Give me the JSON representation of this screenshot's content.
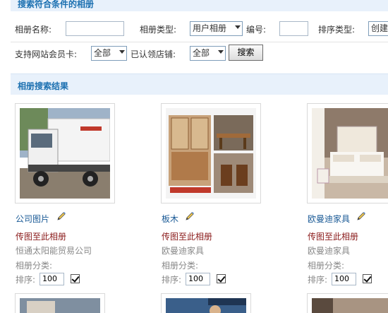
{
  "search_section": {
    "title": "搜索符合条件的相册",
    "album_name_label": "相册名称:",
    "album_name_value": "",
    "album_type_label": "相册类型:",
    "album_type_value": "用户相册",
    "number_label": "编号:",
    "number_value": "",
    "sort_type_label": "排序类型:",
    "sort_type_value": "创建",
    "member_card_label": "支持网站会员卡:",
    "member_card_value": "全部",
    "claimed_store_label": "已认领店铺:",
    "claimed_store_value": "全部",
    "search_button": "搜索"
  },
  "results_section": {
    "title": "相册搜索结果"
  },
  "albums": [
    {
      "title": "公司图片",
      "upload_link": "传图至此相册",
      "owner": "恒通太阳能贸易公司",
      "category_label": "相册分类:",
      "sort_label": "排序:",
      "sort_value": "100",
      "checked": true
    },
    {
      "title": "板木",
      "upload_link": "传图至此相册",
      "owner": "欧曼迪家具",
      "category_label": "相册分类:",
      "sort_label": "排序:",
      "sort_value": "100",
      "checked": true
    },
    {
      "title": "欧曼迪家具",
      "upload_link": "传图至此相册",
      "owner": "欧曼迪家具",
      "category_label": "相册分类:",
      "sort_label": "排序:",
      "sort_value": "100",
      "checked": true
    }
  ],
  "icons": {
    "edit": "pencil-icon",
    "dropdown": "chevron-down-icon"
  },
  "colors": {
    "section_bg": "#e8f1fb",
    "section_title": "#1a6fb0",
    "album_title": "#1a5a96",
    "upload_link": "#8a1a1a"
  }
}
